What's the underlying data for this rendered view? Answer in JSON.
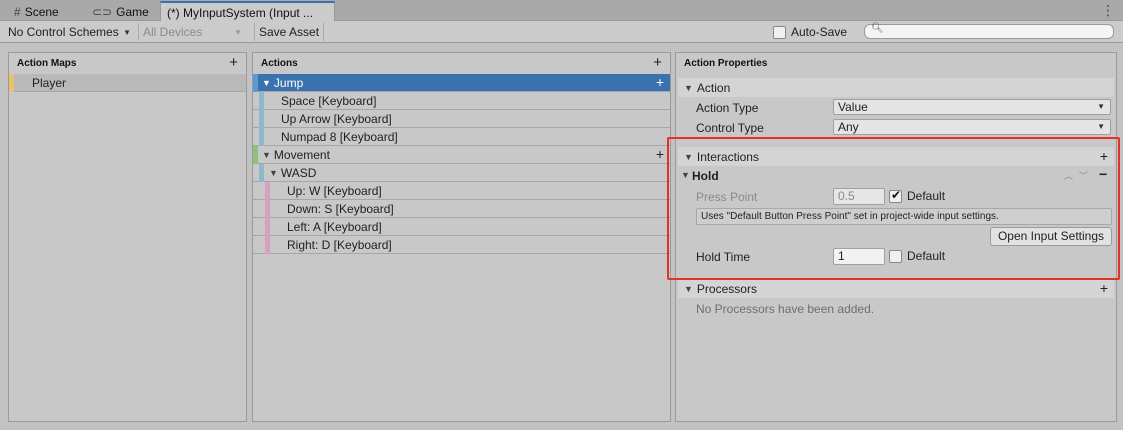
{
  "tabs": [
    {
      "label": "Scene",
      "icon": "grid-icon"
    },
    {
      "label": "Game",
      "icon": "gamepad-icon"
    },
    {
      "label": "(*) MyInputSystem (Input ...",
      "icon": ""
    }
  ],
  "toolbar": {
    "control_scheme": "No Control Schemes",
    "devices": "All Devices",
    "save_asset": "Save Asset",
    "auto_save_label": "Auto-Save",
    "auto_save_checked": false,
    "search_placeholder": ""
  },
  "action_maps": {
    "header": "Action Maps",
    "items": [
      {
        "label": "Player",
        "selected": true
      }
    ]
  },
  "actions": {
    "header": "Actions",
    "rows": [
      {
        "label": "Jump",
        "level": 0,
        "selected": true
      },
      {
        "label": "Space [Keyboard]",
        "level": 1
      },
      {
        "label": "Up Arrow [Keyboard]",
        "level": 1
      },
      {
        "label": "Numpad 8 [Keyboard]",
        "level": 1
      },
      {
        "label": "Movement",
        "level": 0
      },
      {
        "label": "WASD",
        "level": 1
      },
      {
        "label": "Up: W [Keyboard]",
        "level": 2
      },
      {
        "label": "Down: S [Keyboard]",
        "level": 2
      },
      {
        "label": "Left: A [Keyboard]",
        "level": 2
      },
      {
        "label": "Right: D [Keyboard]",
        "level": 2
      }
    ]
  },
  "properties": {
    "header": "Action Properties",
    "action_section": "Action",
    "action_type_label": "Action Type",
    "action_type_value": "Value",
    "control_type_label": "Control Type",
    "control_type_value": "Any",
    "interactions_section": "Interactions",
    "hold_label": "Hold",
    "press_point_label": "Press Point",
    "press_point_value": "0.5",
    "press_point_default_label": "Default",
    "info_text": "Uses \"Default Button Press Point\" set in project-wide input settings.",
    "open_settings_button": "Open Input Settings",
    "hold_time_label": "Hold Time",
    "hold_time_value": "1",
    "hold_time_default_label": "Default",
    "processors_section": "Processors",
    "no_processors_text": "No Processors have been added."
  },
  "colors": {
    "selection": "#3a72b0",
    "map_bar": "#e8c26a",
    "action_bar_jump": "#5b9bd5",
    "action_bar_movement": "#8ec07c",
    "binding_bar": "#8fb8c9",
    "composite_bar": "#d7a1c0",
    "highlight": "#e03323"
  }
}
